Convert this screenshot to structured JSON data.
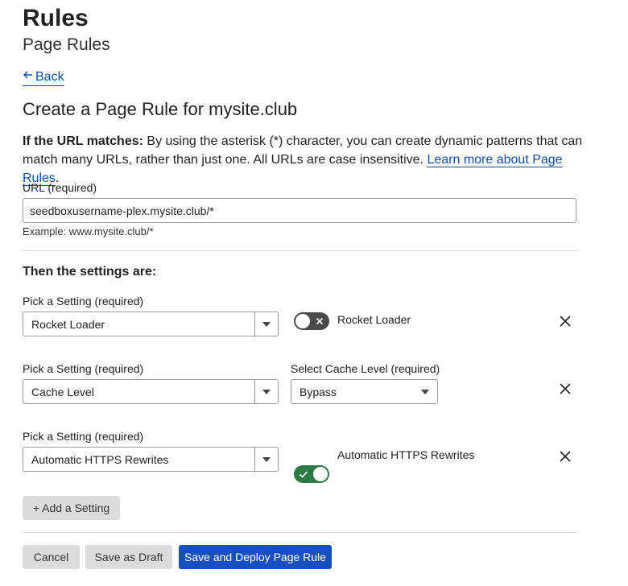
{
  "header": {
    "title": "Rules",
    "subtitle": "Page Rules"
  },
  "back": {
    "label": "Back",
    "icon": "arrow-left-icon"
  },
  "form": {
    "title": "Create a Page Rule for mysite.club",
    "desc_bold": "If the URL matches:",
    "desc_text": " By using the asterisk (*) character, you can create dynamic patterns that can match many URLs, rather than just one. All URLs are case insensitive. ",
    "desc_link": "Learn more about Page Rules",
    "desc_end": ".",
    "url_label": "URL (required)",
    "url_value": "seedboxusername-plex.mysite.club/*",
    "url_example": "Example: www.mysite.club/*"
  },
  "settings": {
    "heading": "Then the settings are:",
    "pick_label": "Pick a Setting (required)",
    "rows": [
      {
        "setting": "Rocket Loader",
        "toggle_state": "off",
        "toggle_label": "Rocket Loader"
      },
      {
        "setting": "Cache Level",
        "extra_label": "Select Cache Level (required)",
        "extra_value": "Bypass"
      },
      {
        "setting": "Automatic HTTPS Rewrites",
        "toggle_state": "on",
        "toggle_label": "Automatic HTTPS Rewrites"
      }
    ],
    "add_label": "+ Add a Setting"
  },
  "actions": {
    "cancel": "Cancel",
    "draft": "Save as Draft",
    "deploy": "Save and Deploy Page Rule"
  },
  "colors": {
    "accent": "#1650c0",
    "link": "#0b4fa5",
    "toggle_on": "#2d7a45",
    "toggle_off": "#4a4a4a"
  }
}
